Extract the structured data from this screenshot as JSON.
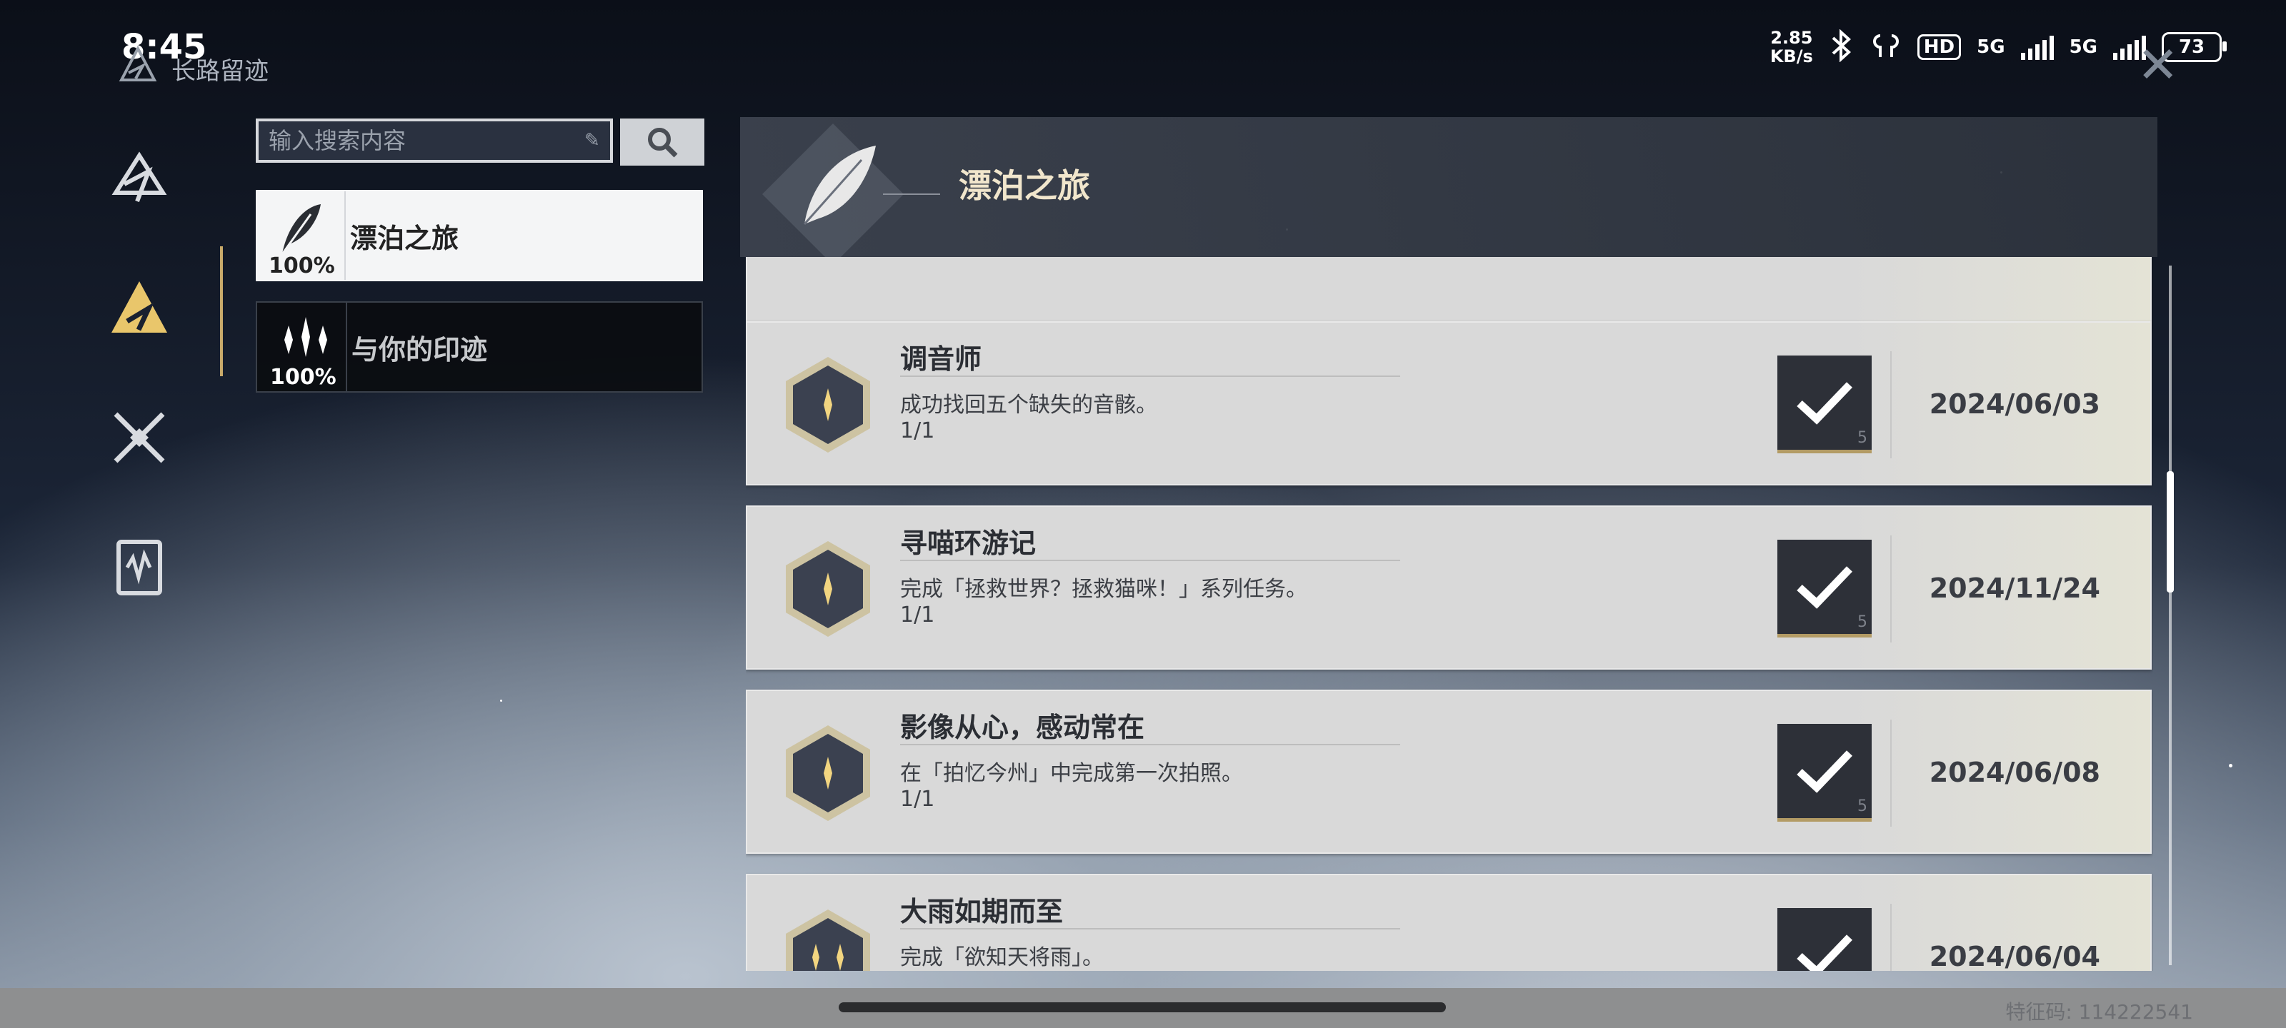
{
  "status_bar": {
    "time": "8:45",
    "net_speed_value": "2.85",
    "net_speed_unit": "KB/s",
    "hd_label": "HD",
    "signal1_label": "5G",
    "signal2_label": "5G",
    "battery": "73"
  },
  "app": {
    "title": "长路留迹",
    "close_symbol": "✕"
  },
  "search": {
    "placeholder": "输入搜索内容",
    "value": ""
  },
  "categories": [
    {
      "label": "漂泊之旅",
      "percent": "100%",
      "active": true,
      "icon": "feather-icon"
    },
    {
      "label": "与你的印迹",
      "percent": "100%",
      "active": false,
      "icon": "sparkle-icon"
    }
  ],
  "panel": {
    "title": "漂泊之旅"
  },
  "achievements": [
    {
      "title": "调音师",
      "desc": "成功找回五个缺失的音骸。",
      "progress": "1/1",
      "date": "2024/06/03",
      "reward": "5",
      "stars": 1
    },
    {
      "title": "寻喵环游记",
      "desc": "完成「拯救世界？拯救猫咪！」系列任务。",
      "progress": "1/1",
      "date": "2024/11/24",
      "reward": "5",
      "stars": 1
    },
    {
      "title": "影像从心，感动常在",
      "desc": "在「拍忆今州」中完成第一次拍照。",
      "progress": "1/1",
      "date": "2024/06/08",
      "reward": "5",
      "stars": 1
    },
    {
      "title": "大雨如期而至",
      "desc": "完成「欲知天将雨」。",
      "progress": "",
      "date": "2024/06/04",
      "reward": "",
      "stars": 2
    }
  ],
  "footer": {
    "uid": "特征码: 114222541"
  },
  "colors": {
    "accent_gold": "#c9aa6a",
    "row_bg": "#d9d9d9",
    "check_bg": "#2d3038"
  }
}
